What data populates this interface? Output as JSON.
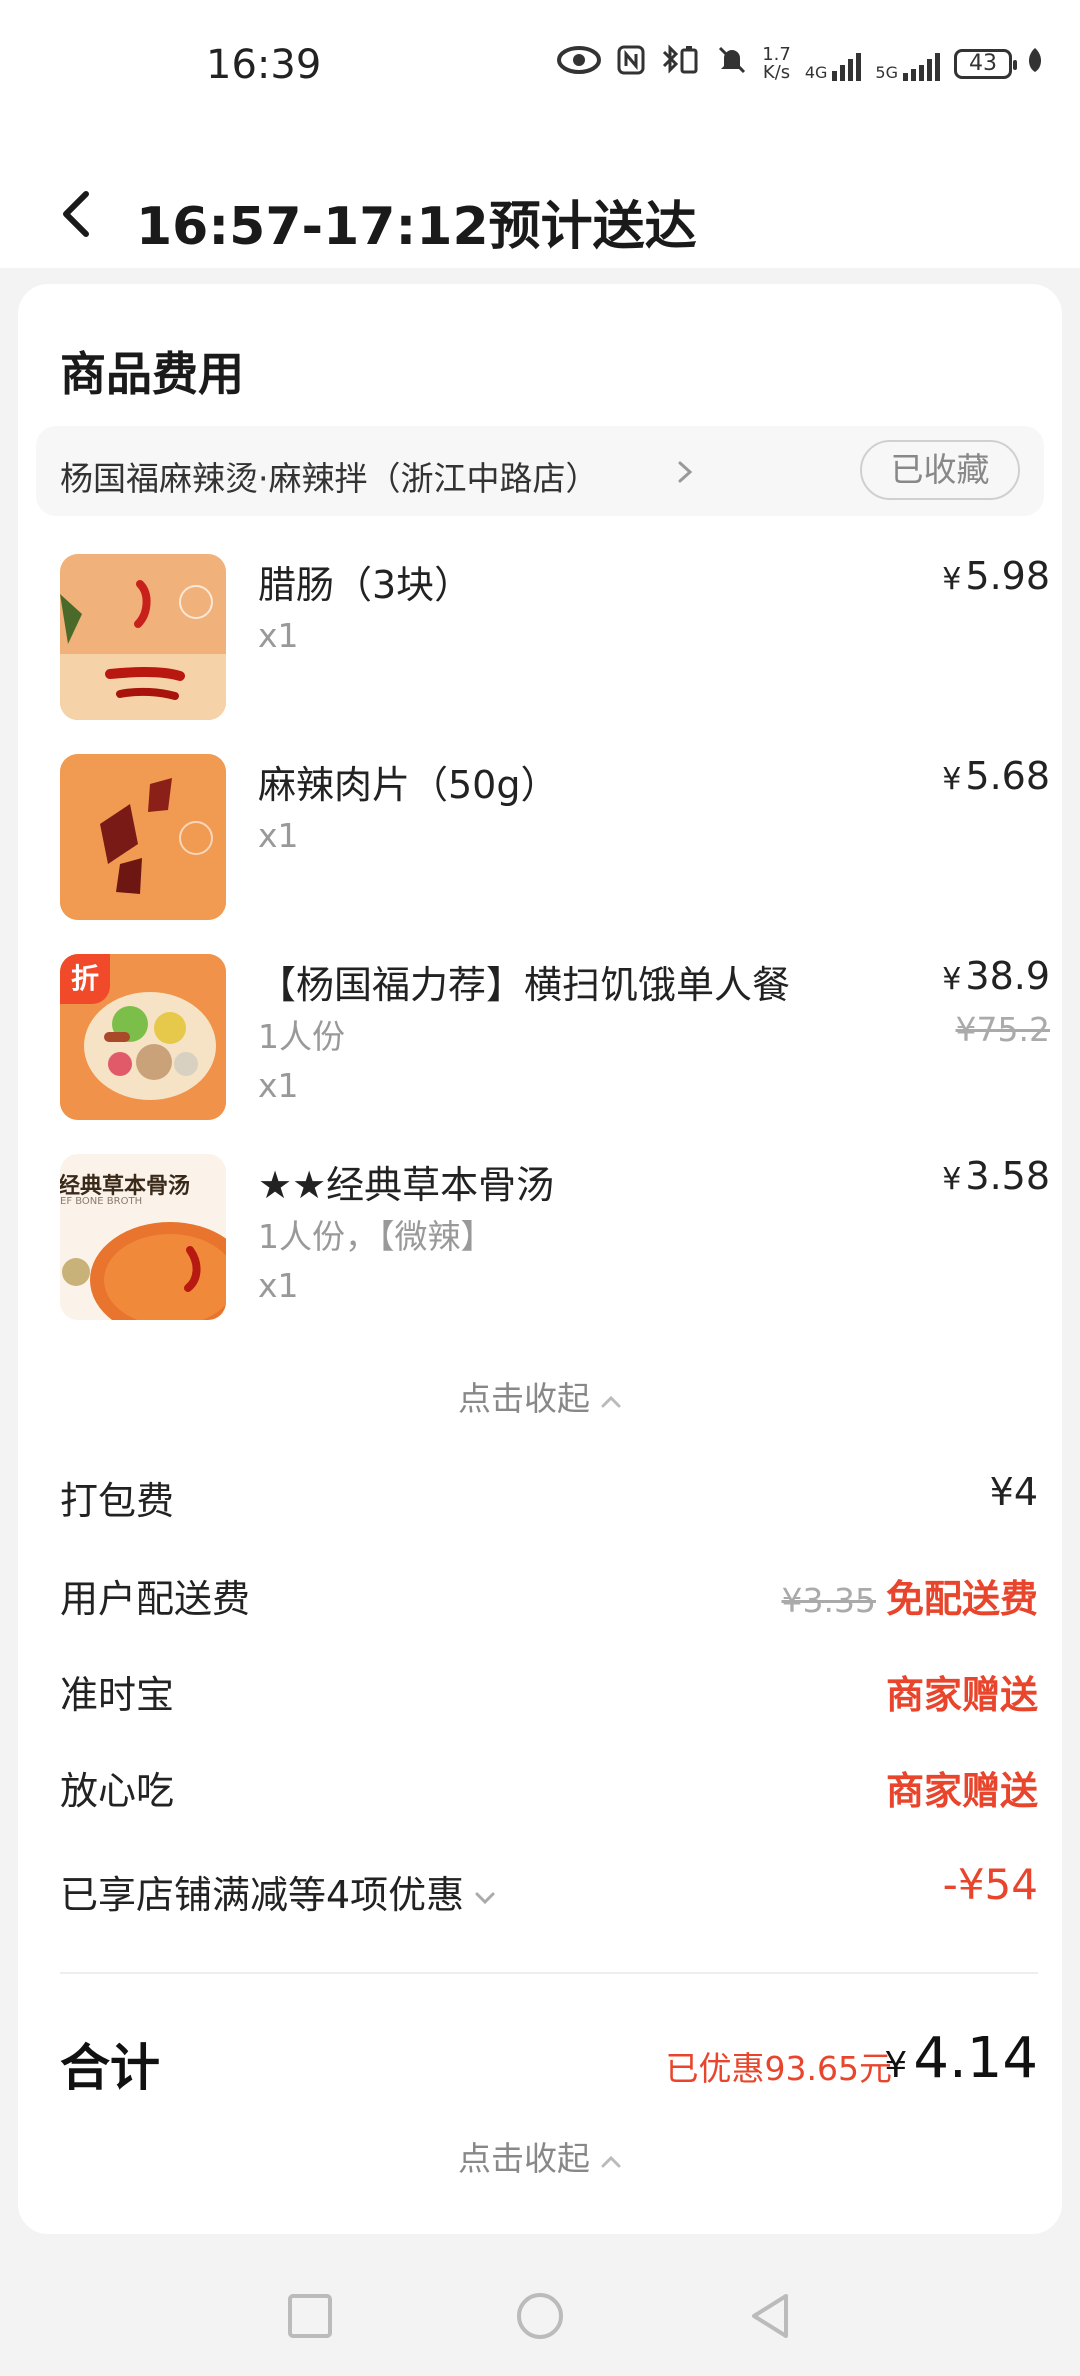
{
  "status_bar": {
    "time": "16:39",
    "net_speed_value": "1.7",
    "net_speed_unit": "K/s",
    "sig1_label": "4G",
    "sig2_label": "5G",
    "battery": "43"
  },
  "header": {
    "title": "16:57-17:12预计送达"
  },
  "card": {
    "section_title": "商品费用",
    "store": {
      "name": "杨国福麻辣烫·麻辣拌（浙江中路店）",
      "favorite_label": "已收藏"
    },
    "items": [
      {
        "name": "腊肠（3块）",
        "spec": "",
        "qty": "x1",
        "price": "5.98",
        "original_price": ""
      },
      {
        "name": "麻辣肉片（50g）",
        "spec": "",
        "qty": "x1",
        "price": "5.68",
        "original_price": ""
      },
      {
        "name": "【杨国福力荐】横扫饥饿单人餐",
        "spec": "1人份",
        "qty": "x1",
        "price": "38.9",
        "original_price": "¥75.2",
        "tag": "折"
      },
      {
        "name": "★★经典草本骨汤",
        "spec": "1人份，【微辣】",
        "qty": "x1",
        "price": "3.58",
        "original_price": "",
        "thumb_text": "经典草本骨汤",
        "thumb_subtext": "EF BONE BROTH"
      }
    ],
    "currency_symbol": "¥",
    "collapse_label": "点击收起",
    "fees": [
      {
        "label": "打包费",
        "value": "¥4"
      },
      {
        "label": "用户配送费",
        "original": "¥3.35",
        "value": "免配送费"
      },
      {
        "label": "准时宝",
        "value": "商家赠送"
      },
      {
        "label": "放心吃",
        "value": "商家赠送"
      },
      {
        "label": "已享店铺满减等4项优惠",
        "value": "-¥54"
      }
    ],
    "total": {
      "label": "合计",
      "saved": "已优惠93.65元",
      "value": "4.14"
    },
    "collapse_label_bottom": "点击收起"
  },
  "colors": {
    "accent_red": "#e8452c",
    "tag_red": "#f04a2a"
  }
}
